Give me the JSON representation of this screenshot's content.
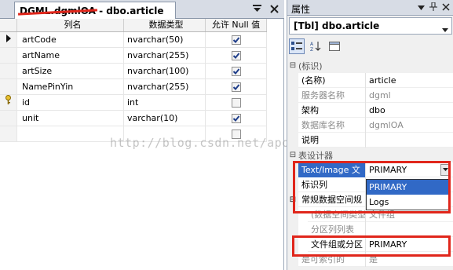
{
  "designer": {
    "tab_title_struck": "DGML.dgmlOA",
    "tab_title_rest": " - dbo.article",
    "columns_header": {
      "name": "列名",
      "type": "数据类型",
      "null": "允许 Null 值"
    },
    "rows": [
      {
        "name": "artCode",
        "type": "nvarchar(50)",
        "nullable": true,
        "marker": "current"
      },
      {
        "name": "artName",
        "type": "nvarchar(255)",
        "nullable": true,
        "marker": ""
      },
      {
        "name": "artSize",
        "type": "nvarchar(100)",
        "nullable": true,
        "marker": ""
      },
      {
        "name": "NamePinYin",
        "type": "nvarchar(255)",
        "nullable": true,
        "marker": ""
      },
      {
        "name": "id",
        "type": "int",
        "nullable": false,
        "marker": "key"
      },
      {
        "name": "unit",
        "type": "varchar(10)",
        "nullable": true,
        "marker": ""
      },
      {
        "name": "",
        "type": "",
        "nullable": false,
        "marker": ""
      }
    ]
  },
  "properties": {
    "title": "属性",
    "object": "[Tbl] dbo.article",
    "cat_identity": "(标识)",
    "cat_designer": "表设计器",
    "rows": {
      "name_label": "(名称)",
      "name_value": "article",
      "server_label": "服务器名称",
      "server_value": "dgml",
      "schema_label": "架构",
      "schema_value": "dbo",
      "db_label": "数据库名称",
      "db_value": "dgmlOA",
      "desc_label": "说明",
      "desc_value": "",
      "textimage_label": "Text/Image 文",
      "textimage_value": "PRIMARY",
      "identity_label": "标识列",
      "regular_label": "常规数据空间规",
      "dataspace_label": "(数据空间类型)",
      "dataspace_value": "文件组",
      "partcol_label": "分区列列表",
      "filegroup_label": "文件组或分区",
      "filegroup_value": "PRIMARY",
      "indexable_label": "是可索引的",
      "indexable_value": "是"
    },
    "dropdown_options": [
      "PRIMARY",
      "Logs"
    ]
  },
  "watermark": "http://blog.csdn.net/apollokk"
}
